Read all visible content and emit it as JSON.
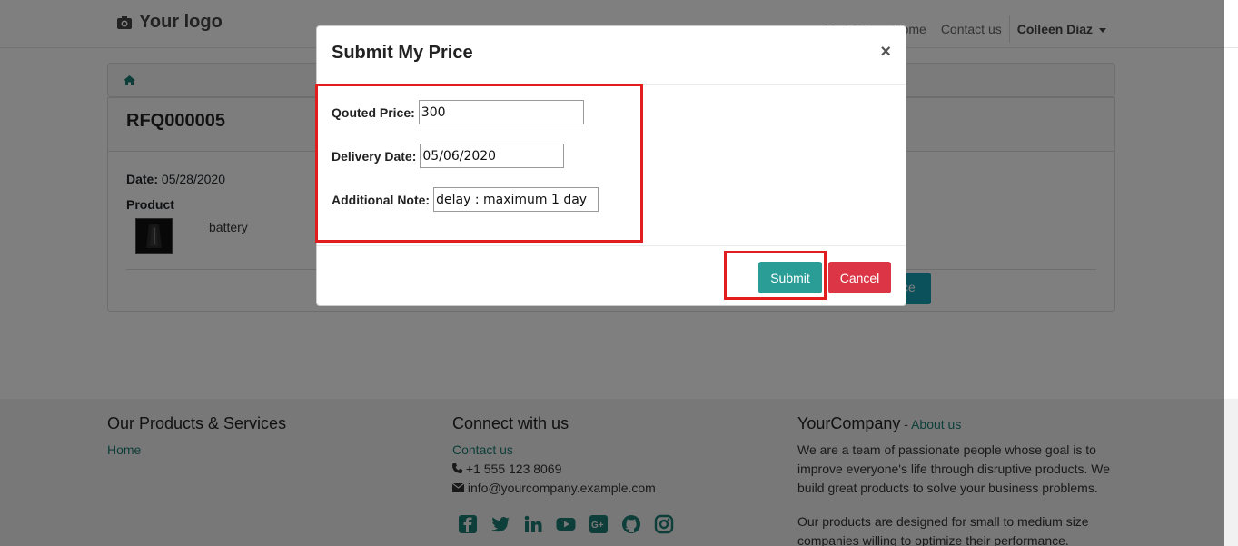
{
  "navbar": {
    "logo_text": "Your logo",
    "links": [
      "My RFQs",
      "Home",
      "Contact us"
    ],
    "user": "Colleen Diaz"
  },
  "rfq": {
    "title": "RFQ000005",
    "date_label": "Date:",
    "date_value": "05/28/2020",
    "product_label": "Product",
    "product_name": "battery",
    "partial_button_text": "ce"
  },
  "modal": {
    "title": "Submit My Price",
    "close": "×",
    "fields": {
      "price_label": "Qouted Price:",
      "price_value": "300",
      "date_label": "Delivery Date:",
      "date_value": "05/06/2020",
      "note_label": "Additional Note:",
      "note_value": "delay : maximum 1 day"
    },
    "submit_label": "Submit",
    "cancel_label": "Cancel"
  },
  "footer": {
    "col1": {
      "title": "Our Products & Services",
      "link": "Home"
    },
    "col2": {
      "title": "Connect with us",
      "link": "Contact us",
      "phone": "+1 555 123 8069",
      "email": "info@yourcompany.example.com"
    },
    "col3": {
      "title": "YourCompany",
      "title_sep": " - ",
      "about_link": "About us",
      "para1": "We are a team of passionate people whose goal is to improve everyone's life through disruptive products. We build great products to solve your business problems.",
      "para2": "Our products are designed for small to medium size companies willing to optimize their performance."
    },
    "social_icons": [
      "facebook-icon",
      "twitter-icon",
      "linkedin-icon",
      "youtube-icon",
      "google-plus-icon",
      "github-icon",
      "instagram-icon"
    ]
  },
  "colors": {
    "accent": "#2a9d96",
    "danger": "#dc3545",
    "highlight": "#e11d1d"
  }
}
